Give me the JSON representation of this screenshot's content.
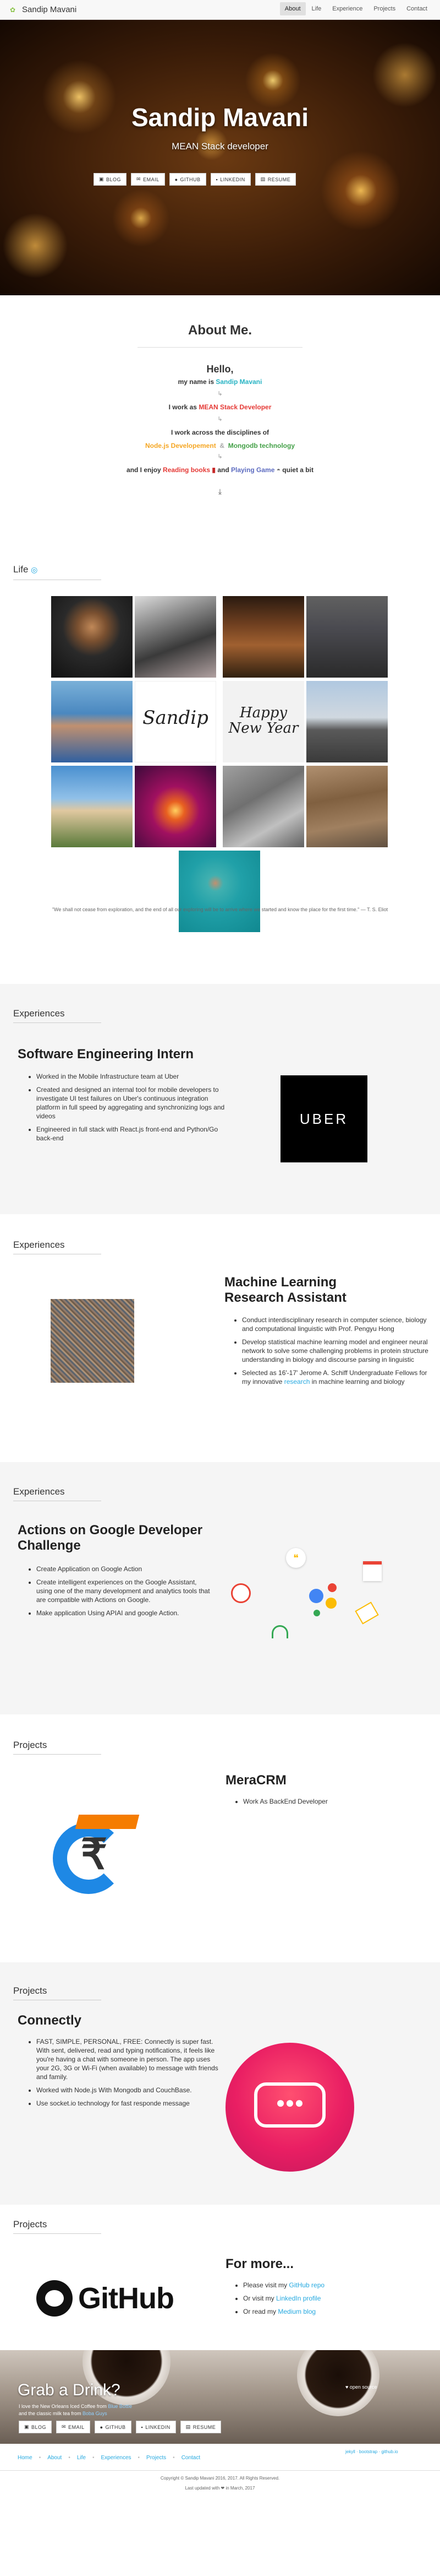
{
  "nav": {
    "brand": "Sandip Mavani",
    "links": [
      "About",
      "Life",
      "Experience",
      "Projects",
      "Contact"
    ]
  },
  "hero": {
    "title": "Sandip Mavani",
    "subtitle": "MEAN Stack developer",
    "buttons": [
      "BLOG",
      "EMAIL",
      "GITHUB",
      "LINKEDIN",
      "RESUME"
    ]
  },
  "about": {
    "heading": "About Me.",
    "hello": "Hello,",
    "line1_pre": "my name is ",
    "line1_name": "Sandip Mavani",
    "line2_pre": "I work as ",
    "line2_role": "MEAN Stack Developer",
    "line3": "I work across the disciplines of",
    "line4_a": "Node.js Developement",
    "line4_amp": "&",
    "line4_b": "Mongodb technology",
    "line5_pre": "and I enjoy ",
    "line5_a": "Reading books",
    "line5_mid": " and ",
    "line5_b": "Playing Game",
    "line5_post": " quiet a bit"
  },
  "life": {
    "heading": "Life",
    "photos": [
      "Person with headphones",
      "Musician at keyboard",
      "Cooking in kitchen",
      "Group in garage",
      "Portrait",
      "Sandip signature",
      "Happy New Year",
      "Motorcycle",
      "Palace",
      "Diwali lamp",
      "Old tree",
      "Hillside",
      "Swimming pool"
    ],
    "quote": "\"We shall not cease from exploration, and the end of all our exploring will be to arrive where we started and know the place for the first time.\" — T. S. Eliot"
  },
  "exp1": {
    "heading": "Experiences",
    "title": "Software Engineering Intern",
    "logo": "UBER",
    "bullets": [
      "Worked in the Mobile Infrastructure team at Uber",
      "Created and designed an internal tool for mobile developers to investigate UI test failures on Uber's continuous integration platform in full speed by aggregating and synchronizing logs and videos",
      "Engineered in full stack with React.js front-end and Python/Go back-end"
    ]
  },
  "exp2": {
    "heading": "Experiences",
    "title": "Machine Learning Research Assistant",
    "bullets": [
      "Conduct interdisciplinary research in computer science, biology and computational linguistic with Prof. Pengyu Hong",
      "Develop statistical machine learning model and engineer neural network to solve some challenging problems in protein structure understanding in biology and discourse parsing in linguistic",
      "Selected as 16'-17' Jerome A. Schiff Undergraduate Fellows for my innovative "
    ],
    "bullet3_link": "research",
    "bullet3_post": " in machine learning and biology"
  },
  "exp3": {
    "heading": "Experiences",
    "title": "Actions on Google Developer Challenge",
    "bullets": [
      "Create Application on Google Action",
      "Create intelligent experiences on the Google Assistant, using one of the many development and analytics tools that are compatible with Actions on Google.",
      "Make application Using APIAI and google Action."
    ]
  },
  "proj1": {
    "heading": "Projects",
    "title": "MeraCRM",
    "bullets": [
      "Work As BackEnd Developer"
    ],
    "logo_glyph": "₹"
  },
  "proj2": {
    "heading": "Projects",
    "title": "Connectly",
    "bullets": [
      "FAST, SIMPLE, PERSONAL, FREE: Connectly is super fast. With sent, delivered, read and typing notifications, it feels like you're having a chat with someone in person. The app uses your 2G, 3G or Wi-Fi (when available) to message with friends and family.",
      "Worked with Node.js With Mongodb and CouchBase.",
      "Use socket.io technology for fast responde message"
    ]
  },
  "proj3": {
    "heading": "Projects",
    "title": "For more...",
    "github": "GitHub",
    "items": [
      {
        "pre": "Please visit my ",
        "link": "GitHub repo"
      },
      {
        "pre": "Or visit my ",
        "link": "LinkedIn profile"
      },
      {
        "pre": "Or read my ",
        "link": "Medium blog"
      }
    ]
  },
  "drink": {
    "title": "Grab a Drink?",
    "line1_pre": "I love the New Orleans Iced Coffee from ",
    "line1_link": "Blue Bottle",
    "line2_pre": "and the classic milk tea from ",
    "line2_link": "Boba Guys",
    "buttons": [
      "BLOG",
      "EMAIL",
      "GITHUB",
      "LINKEDIN",
      "RESUME"
    ],
    "os": "♥ open source",
    "os_links": "jekyll · bootstrap · github.io"
  },
  "footer": {
    "links": [
      "Home",
      "About",
      "Life",
      "Experiences",
      "Projects",
      "Contact"
    ],
    "copyright": "Copyright © Sandip Mavani 2016, 2017. All Rights Reserved.",
    "updated": "Last updated with ❤ in March, 2017"
  }
}
